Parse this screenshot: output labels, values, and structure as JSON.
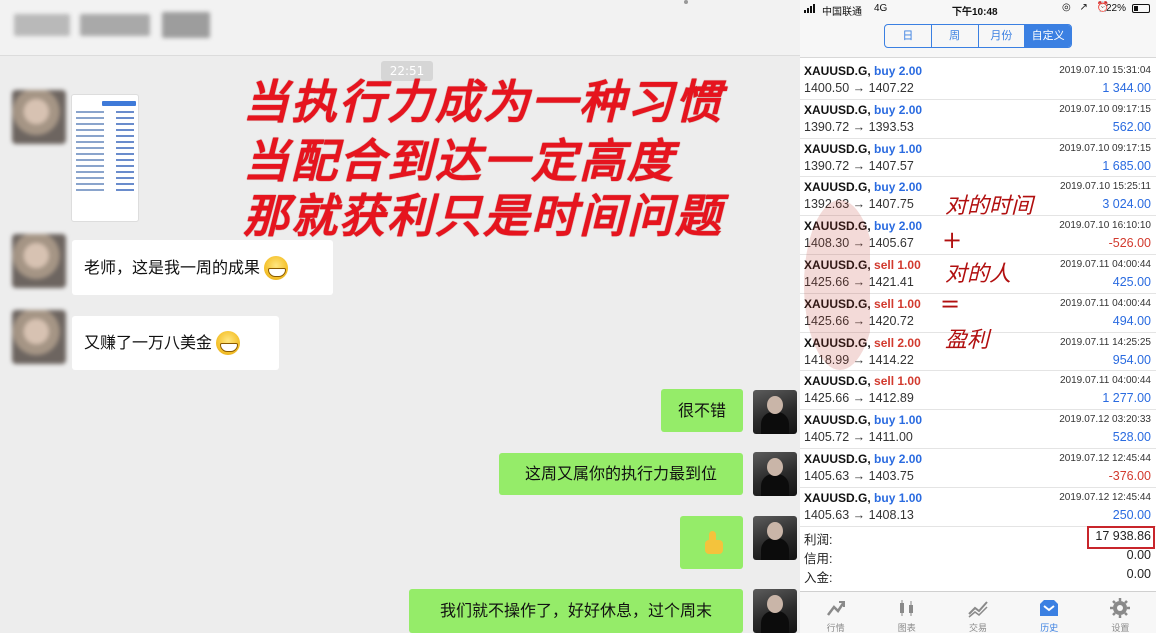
{
  "chat": {
    "timestamp": "22:51",
    "overlay_lines": [
      "当执行力成为一种习惯",
      "当配合到达一定高度",
      "那就获利只是时间问题"
    ],
    "messages": [
      {
        "side": "left",
        "text": "老师，这是我一周的成果",
        "emoji": "grin-icon"
      },
      {
        "side": "left",
        "text": "又赚了一万八美金",
        "emoji": "grin-icon"
      },
      {
        "side": "right",
        "text": "很不错"
      },
      {
        "side": "right",
        "text": "这周又属你的执行力最到位"
      },
      {
        "side": "right",
        "text": "",
        "emoji": "thumbs-up-icon"
      },
      {
        "side": "right",
        "text": "我们就不操作了，好好休息，过个周末"
      }
    ]
  },
  "phone": {
    "status": {
      "carrier": "中国联通",
      "network": "4G",
      "time": "下午10:48",
      "battery": "22%"
    },
    "segments": [
      "日",
      "周",
      "月份",
      "自定义"
    ],
    "active_segment": 3,
    "deals": [
      {
        "symbol": "XAUUSD.G,",
        "side": "buy",
        "volume": "buy 2.00",
        "prices": "1400.50 → 1407.22",
        "time": "2019.07.10 15:31:04",
        "profit": "1 344.00"
      },
      {
        "symbol": "XAUUSD.G,",
        "side": "buy",
        "volume": "buy 2.00",
        "prices": "1390.72 → 1393.53",
        "time": "2019.07.10 09:17:15",
        "profit": "562.00"
      },
      {
        "symbol": "XAUUSD.G,",
        "side": "buy",
        "volume": "buy 1.00",
        "prices": "1390.72 → 1407.57",
        "time": "2019.07.10 09:17:15",
        "profit": "1 685.00"
      },
      {
        "symbol": "XAUUSD.G,",
        "side": "buy",
        "volume": "buy 2.00",
        "prices": "1392.63 → 1407.75",
        "time": "2019.07.10 15:25:11",
        "profit": "3 024.00"
      },
      {
        "symbol": "XAUUSD.G,",
        "side": "buy",
        "volume": "buy 2.00",
        "prices": "1408.30 → 1405.67",
        "time": "2019.07.10 16:10:10",
        "profit": "-526.00"
      },
      {
        "symbol": "XAUUSD.G,",
        "side": "sell",
        "volume": "sell 1.00",
        "prices": "1425.66 → 1421.41",
        "time": "2019.07.11 04:00:44",
        "profit": "425.00"
      },
      {
        "symbol": "XAUUSD.G,",
        "side": "sell",
        "volume": "sell 1.00",
        "prices": "1425.66 → 1420.72",
        "time": "2019.07.11 04:00:44",
        "profit": "494.00"
      },
      {
        "symbol": "XAUUSD.G,",
        "side": "sell",
        "volume": "sell 2.00",
        "prices": "1418.99 → 1414.22",
        "time": "2019.07.11 14:25:25",
        "profit": "954.00"
      },
      {
        "symbol": "XAUUSD.G,",
        "side": "sell",
        "volume": "sell 1.00",
        "prices": "1425.66 → 1412.89",
        "time": "2019.07.11 04:00:44",
        "profit": "1 277.00"
      },
      {
        "symbol": "XAUUSD.G,",
        "side": "buy",
        "volume": "buy 1.00",
        "prices": "1405.72 → 1411.00",
        "time": "2019.07.12 03:20:33",
        "profit": "528.00"
      },
      {
        "symbol": "XAUUSD.G,",
        "side": "buy",
        "volume": "buy 2.00",
        "prices": "1405.63 → 1403.75",
        "time": "2019.07.12 12:45:44",
        "profit": "-376.00"
      },
      {
        "symbol": "XAUUSD.G,",
        "side": "buy",
        "volume": "buy 1.00",
        "prices": "1405.63 → 1408.13",
        "time": "2019.07.12 12:45:44",
        "profit": "250.00"
      }
    ],
    "summary": [
      {
        "label": "利润:",
        "value": "17 938.86"
      },
      {
        "label": "信用:",
        "value": "0.00"
      },
      {
        "label": "入金:",
        "value": "0.00"
      }
    ],
    "notes": [
      "对的时间",
      "+",
      "对的人",
      "=",
      "盈利"
    ],
    "tabs": [
      {
        "label": "行情",
        "icon": "quotes-icon"
      },
      {
        "label": "图表",
        "icon": "chart-icon"
      },
      {
        "label": "交易",
        "icon": "trade-icon"
      },
      {
        "label": "历史",
        "icon": "history-icon"
      },
      {
        "label": "设置",
        "icon": "settings-icon"
      }
    ],
    "active_tab": 3,
    "colors": {
      "accent": "#3b80e2",
      "profit_positive": "#2a6be0",
      "profit_negative": "#d23a2e",
      "bubble_me": "#95ec69",
      "overlay_red": "#e6141e"
    }
  }
}
